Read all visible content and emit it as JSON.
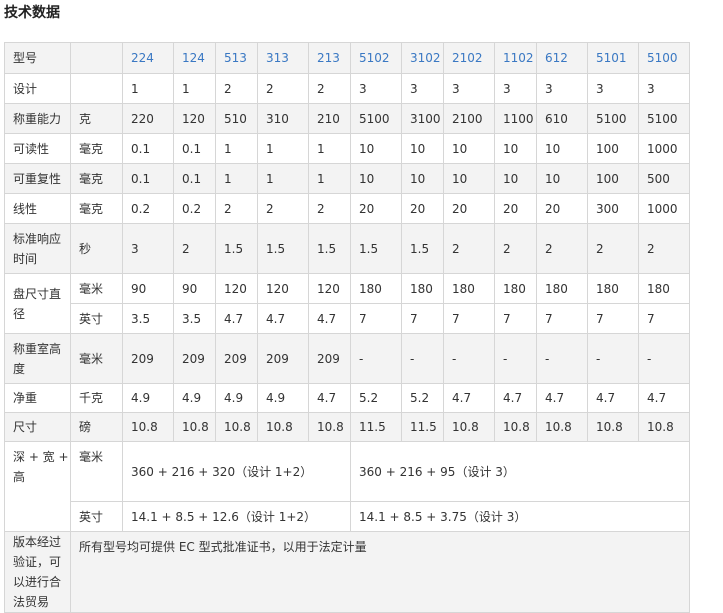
{
  "page_title": "技术数据",
  "models": [
    "224",
    "124",
    "513",
    "313",
    "213",
    "5102",
    "3102",
    "2102",
    "1102",
    "612",
    "5101",
    "5100"
  ],
  "rows": {
    "model_label": "型号",
    "design": {
      "label": "设计",
      "unit": "",
      "values": [
        "1",
        "1",
        "2",
        "2",
        "2",
        "3",
        "3",
        "3",
        "3",
        "3",
        "3",
        "3"
      ]
    },
    "capacity": {
      "label": "称重能力",
      "unit": "克",
      "values": [
        "220",
        "120",
        "510",
        "310",
        "210",
        "5100",
        "3100",
        "2100",
        "1100",
        "610",
        "5100",
        "5100"
      ]
    },
    "readability": {
      "label": "可读性",
      "unit": "毫克",
      "values": [
        "0.1",
        "0.1",
        "1",
        "1",
        "1",
        "10",
        "10",
        "10",
        "10",
        "10",
        "100",
        "1000"
      ]
    },
    "repeatability": {
      "label": "可重复性",
      "unit": "毫克",
      "values": [
        "0.1",
        "0.1",
        "1",
        "1",
        "1",
        "10",
        "10",
        "10",
        "10",
        "10",
        "100",
        "500"
      ]
    },
    "linearity": {
      "label": "线性",
      "unit": "毫克",
      "values": [
        "0.2",
        "0.2",
        "2",
        "2",
        "2",
        "20",
        "20",
        "20",
        "20",
        "20",
        "300",
        "1000"
      ]
    },
    "response_time": {
      "label": "标准响应时间",
      "unit": "秒",
      "values": [
        "3",
        "2",
        "1.5",
        "1.5",
        "1.5",
        "1.5",
        "1.5",
        "2",
        "2",
        "2",
        "2",
        "2"
      ]
    },
    "pan_size": {
      "label": "盘尺寸直径",
      "unit_mm": "毫米",
      "values_mm": [
        "90",
        "90",
        "120",
        "120",
        "120",
        "180",
        "180",
        "180",
        "180",
        "180",
        "180",
        "180"
      ],
      "unit_in": "英寸",
      "values_in": [
        "3.5",
        "3.5",
        "4.7",
        "4.7",
        "4.7",
        "7",
        "7",
        "7",
        "7",
        "7",
        "7",
        "7"
      ]
    },
    "chamber_height": {
      "label": "称重室高度",
      "unit": "毫米",
      "values": [
        "209",
        "209",
        "209",
        "209",
        "209",
        "-",
        "-",
        "-",
        "-",
        "-",
        "-",
        "-"
      ]
    },
    "net_weight": {
      "label": "净重",
      "unit": "千克",
      "values": [
        "4.9",
        "4.9",
        "4.9",
        "4.9",
        "4.7",
        "5.2",
        "5.2",
        "4.7",
        "4.7",
        "4.7",
        "4.7",
        "4.7"
      ]
    },
    "dimension_lb": {
      "label": "尺寸",
      "unit": "磅",
      "values": [
        "10.8",
        "10.8",
        "10.8",
        "10.8",
        "10.8",
        "11.5",
        "11.5",
        "10.8",
        "10.8",
        "10.8",
        "10.8",
        "10.8"
      ]
    },
    "dims": {
      "label": "深 + 宽 + 高",
      "unit_mm": "毫米",
      "mm_a": "360 + 216 + 320（设计 1+2）",
      "mm_b": "360 + 216 + 95（设计 3）",
      "unit_in": "英寸",
      "in_a": "14.1 + 8.5 + 12.6（设计 1+2）",
      "in_b": "14.1 + 8.5 + 3.75（设计 3）"
    },
    "certification": {
      "label": "版本经过验证，可以进行合法贸易",
      "value": "所有型号均可提供 EC 型式批准证书，以用于法定计量"
    }
  }
}
